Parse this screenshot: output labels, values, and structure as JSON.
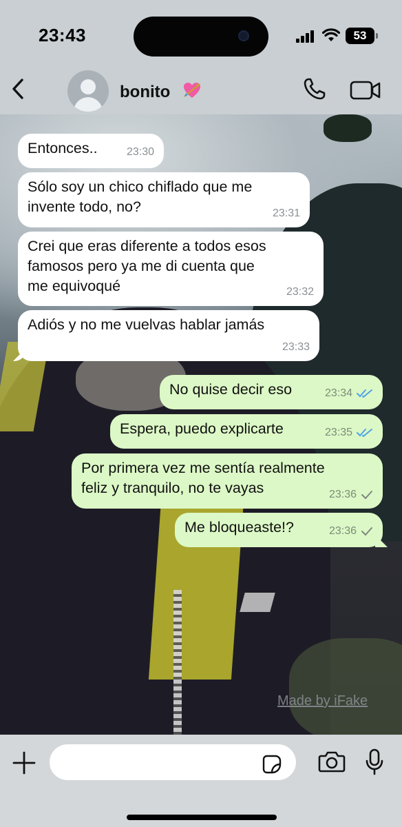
{
  "status_bar": {
    "time": "23:43",
    "battery": "53"
  },
  "header": {
    "contact_name": "bonito"
  },
  "messages": [
    {
      "direction": "incoming",
      "lines": [
        "Entonces.."
      ],
      "time": "23:30"
    },
    {
      "direction": "incoming",
      "lines": [
        "Sólo soy un chico chiflado que me",
        "invente todo, no?"
      ],
      "time": "23:31"
    },
    {
      "direction": "incoming",
      "lines": [
        "Crei que eras diferente a todos esos",
        "famosos pero ya me di cuenta que",
        "me equivoqué"
      ],
      "time": "23:32"
    },
    {
      "direction": "incoming",
      "lines": [
        "Adiós y no me vuelvas hablar jamás"
      ],
      "time": "23:33"
    },
    {
      "direction": "outgoing",
      "lines": [
        "No quise decir eso"
      ],
      "time": "23:34",
      "status": "read"
    },
    {
      "direction": "outgoing",
      "lines": [
        "Espera, puedo explicarte"
      ],
      "time": "23:35",
      "status": "read"
    },
    {
      "direction": "outgoing",
      "lines": [
        "Por primera vez me sentía realmente",
        "feliz y tranquilo, no te vayas"
      ],
      "time": "23:36",
      "status": "sent"
    },
    {
      "direction": "outgoing",
      "lines": [
        "Me bloqueaste!?"
      ],
      "time": "23:36",
      "status": "sent"
    }
  ],
  "watermark": "Made by iFake",
  "composer": {
    "placeholder": ""
  },
  "colors": {
    "incoming_bubble": "#ffffff",
    "outgoing_bubble": "#dcf8c6",
    "read_tick": "#4fa3ea",
    "sent_tick": "#8a8f93"
  }
}
